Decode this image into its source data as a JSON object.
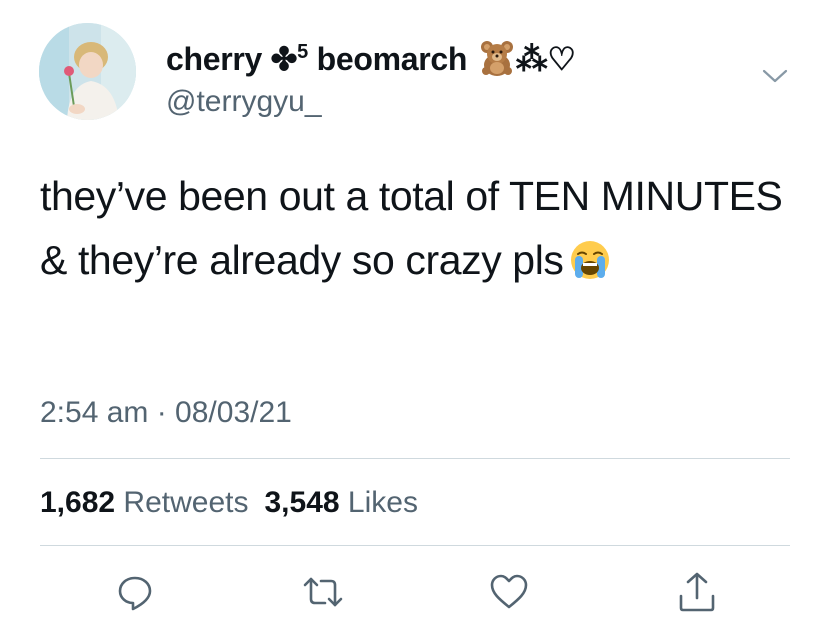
{
  "author": {
    "name_part1": "cherry ",
    "name_symbol": "✤",
    "name_sup": "5",
    "name_part2": " beomarch ",
    "name_suffix": "⁂♡",
    "handle": "@terrygyu_"
  },
  "tweet": {
    "text": "they’ve been out a total of TEN MINUTES & they’re already so crazy pls",
    "emoji": "loudly-crying-face",
    "timestamp": "2:54 am · 08/03/21"
  },
  "stats": {
    "retweets_count": "1,682",
    "retweets_label": "Retweets",
    "likes_count": "3,548",
    "likes_label": "Likes"
  },
  "actions": [
    {
      "icon": "reply-icon"
    },
    {
      "icon": "retweet-icon"
    },
    {
      "icon": "like-icon"
    },
    {
      "icon": "share-icon"
    }
  ],
  "colors": {
    "text": "#0f1419",
    "secondary": "#536471",
    "divider": "#cfd9de"
  }
}
